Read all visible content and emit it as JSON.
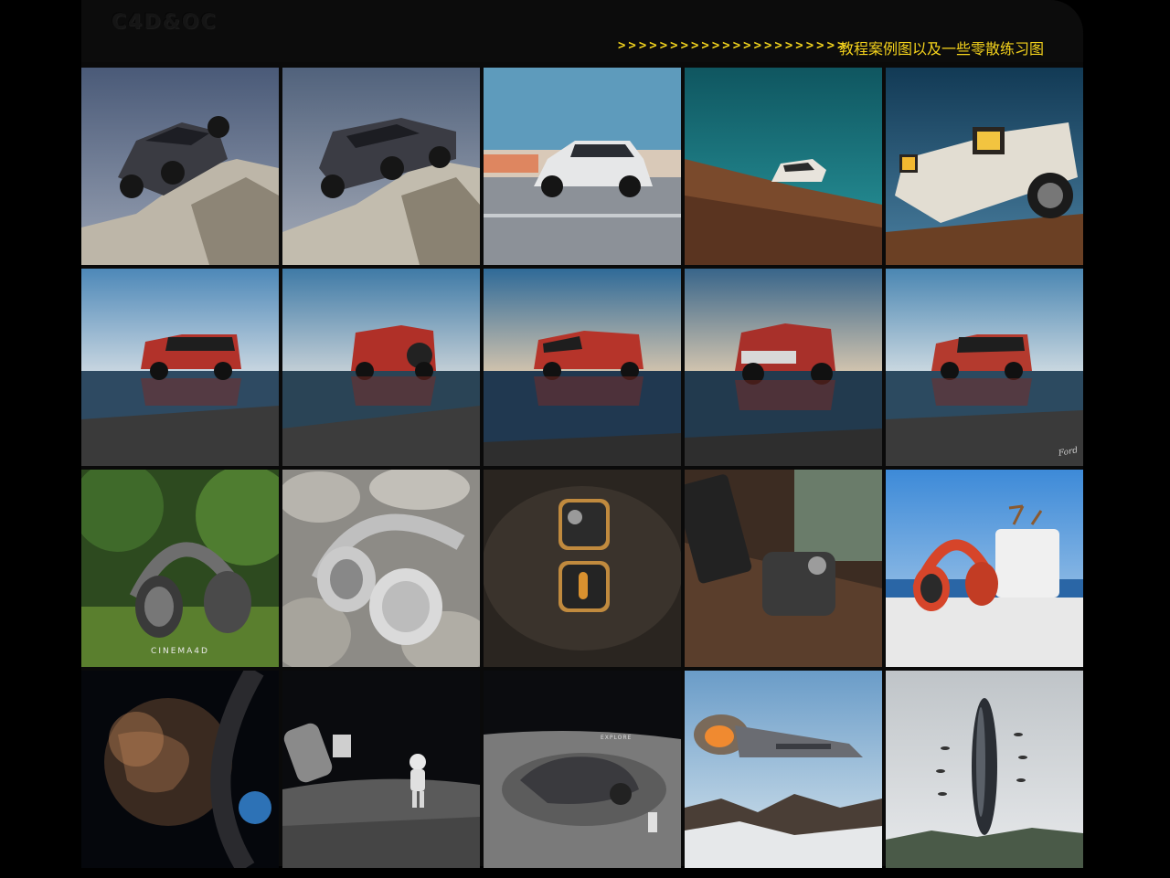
{
  "header": {
    "logo": "C4D&OC",
    "arrows": ">>>>>>>>>>>>>>>>>>>>>>",
    "title": "教程案例图以及一些零散练习图"
  },
  "tiles": [
    {
      "row": 1,
      "subject": "grey-suv-on-rock-low-angle",
      "caption": ""
    },
    {
      "row": 1,
      "subject": "grey-suv-on-rock-side",
      "caption": ""
    },
    {
      "row": 1,
      "subject": "white-suv-road-motion",
      "caption": ""
    },
    {
      "row": 1,
      "subject": "classic-car-on-dirt-hill",
      "caption": ""
    },
    {
      "row": 1,
      "subject": "classic-car-headlights-closeup",
      "caption": ""
    },
    {
      "row": 2,
      "subject": "red-suv-water-reflection",
      "caption": ""
    },
    {
      "row": 2,
      "subject": "red-suv-rear-reflection",
      "caption": ""
    },
    {
      "row": 2,
      "subject": "red-suv-front-reflection",
      "caption": ""
    },
    {
      "row": 2,
      "subject": "red-suv-front-dusk",
      "caption": ""
    },
    {
      "row": 2,
      "subject": "red-suv-side-reflection",
      "caption": "Ford"
    },
    {
      "row": 3,
      "subject": "headphones-grass",
      "caption": "CINEMA4D"
    },
    {
      "row": 3,
      "subject": "headphones-stones",
      "caption": ""
    },
    {
      "row": 3,
      "subject": "speakers-on-stone",
      "caption": ""
    },
    {
      "row": 3,
      "subject": "speaker-wooden-table",
      "caption": ""
    },
    {
      "row": 3,
      "subject": "red-headphones-sky",
      "caption": ""
    },
    {
      "row": 4,
      "subject": "planet-and-ring-station",
      "caption": ""
    },
    {
      "row": 4,
      "subject": "astronaut-moon-capsule",
      "caption": ""
    },
    {
      "row": 4,
      "subject": "lunar-rover-crater",
      "caption": "EXPLORE"
    },
    {
      "row": 4,
      "subject": "spaceship-over-mountains",
      "caption": ""
    },
    {
      "row": 4,
      "subject": "ufo-monolith-sky",
      "caption": ""
    }
  ]
}
